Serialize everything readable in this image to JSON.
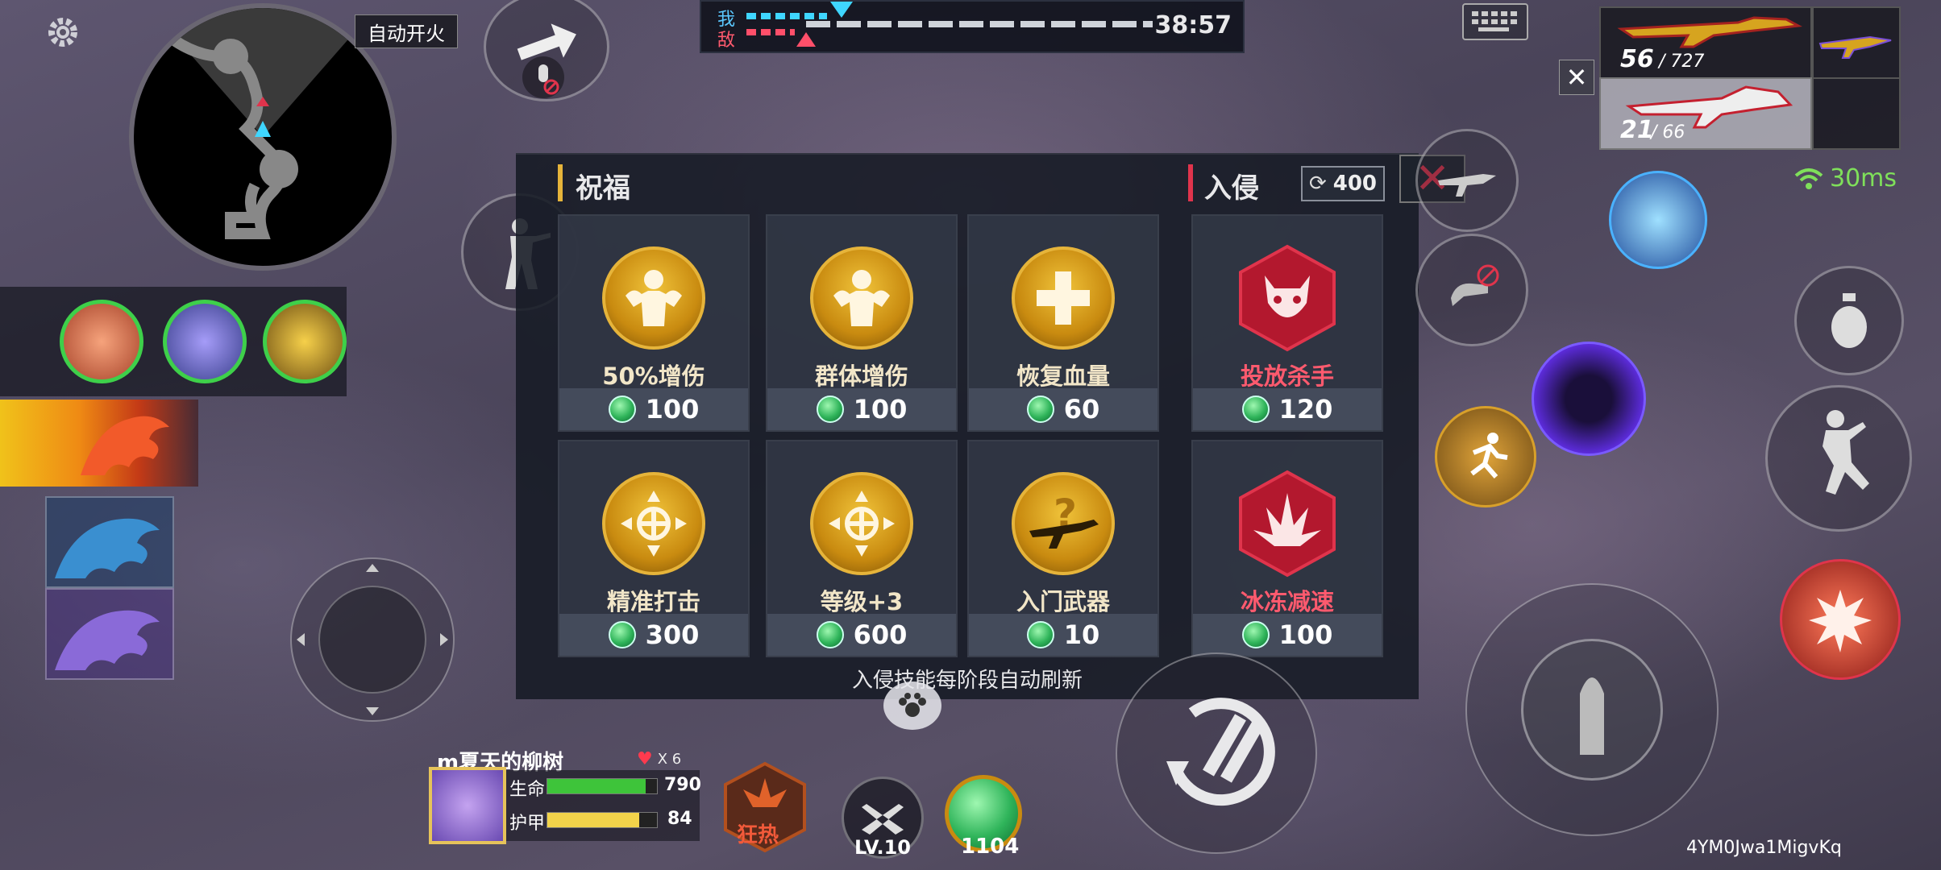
{
  "hud": {
    "auto_fire_label": "自动开火",
    "team_labels": {
      "ally": "我",
      "enemy": "敌"
    },
    "match_timer": "38:57",
    "ping": "30ms",
    "player_id_code": "4YM0Jwa1MigvKq"
  },
  "weapons": {
    "primary_ammo": "56",
    "primary_reserve": "/ 727",
    "secondary_ammo": "21",
    "secondary_reserve": "/ 66"
  },
  "panel": {
    "blessing_title": "祝福",
    "invasion_title": "入侵",
    "refresh_cost": "400",
    "footer_note": "入侵技能每阶段自动刷新",
    "cards": [
      {
        "name": "50%增伤",
        "price": "100",
        "icon": "muscle-icon",
        "style": "gold"
      },
      {
        "name": "群体增伤",
        "price": "100",
        "icon": "muscle-group-icon",
        "style": "gold"
      },
      {
        "name": "恢复血量",
        "price": "60",
        "icon": "heal-plus-icon",
        "style": "gold"
      },
      {
        "name": "投放杀手",
        "price": "120",
        "icon": "demon-mask-icon",
        "style": "red"
      },
      {
        "name": "精准打击",
        "price": "300",
        "icon": "crosshair-icon",
        "style": "gold"
      },
      {
        "name": "等级+3",
        "price": "600",
        "icon": "crosshair-level-icon",
        "style": "gold"
      },
      {
        "name": "入门武器",
        "price": "10",
        "icon": "rifle-mystery-icon",
        "style": "gold"
      },
      {
        "name": "冰冻减速",
        "price": "100",
        "icon": "ice-crystal-icon",
        "style": "red"
      }
    ]
  },
  "player": {
    "name": "m夏天的柳树",
    "lives": "X 6",
    "hp_label": "生命",
    "hp_value": "790",
    "hp_fraction": 0.9,
    "armor_label": "护甲",
    "armor_value": "84",
    "armor_fraction": 0.84,
    "frenzy_label": "狂热",
    "level": "LV.10",
    "coins": "1104"
  },
  "colors": {
    "accent_gold": "#e6b43a",
    "accent_red": "#e0344c",
    "ping_green": "#7fe05a",
    "hp_green": "#3ec43a",
    "armor_yellow": "#f2d34a"
  }
}
